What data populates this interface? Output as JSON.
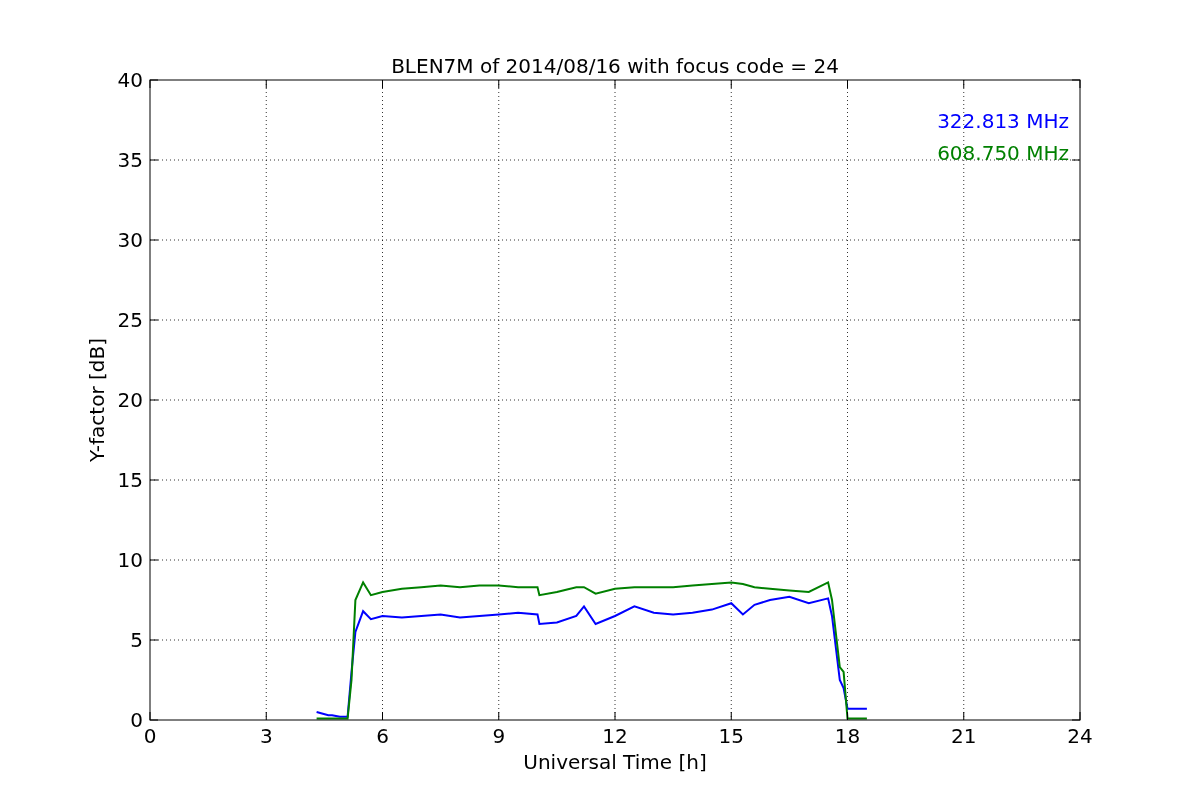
{
  "chart_data": {
    "type": "line",
    "title": "BLEN7M of 2014/08/16 with focus code = 24",
    "xlabel": "Universal Time [h]",
    "ylabel": "Y-factor [dB]",
    "xlim": [
      0,
      24
    ],
    "ylim": [
      0,
      40
    ],
    "xticks": [
      0,
      3,
      6,
      9,
      12,
      15,
      18,
      21,
      24
    ],
    "yticks": [
      0,
      5,
      10,
      15,
      20,
      25,
      30,
      35,
      40
    ],
    "grid": true,
    "x": [
      4.3,
      4.6,
      4.7,
      4.9,
      5.1,
      5.2,
      5.3,
      5.5,
      5.7,
      6,
      6.5,
      7,
      7.5,
      8,
      8.5,
      9,
      9.5,
      10,
      10.05,
      10.5,
      11,
      11.2,
      11.5,
      12,
      12.5,
      13,
      13.5,
      14,
      14.5,
      15,
      15.3,
      15.6,
      16,
      16.5,
      17,
      17.5,
      17.6,
      17.8,
      17.9,
      18,
      18.5
    ],
    "series": [
      {
        "name": "322.813 MHz",
        "color": "#0000ff",
        "values": [
          0.5,
          0.3,
          0.3,
          0.2,
          0.2,
          3,
          5.5,
          6.8,
          6.3,
          6.5,
          6.4,
          6.5,
          6.6,
          6.4,
          6.5,
          6.6,
          6.7,
          6.6,
          6.0,
          6.1,
          6.5,
          7.1,
          6.0,
          6.5,
          7.1,
          6.7,
          6.6,
          6.7,
          6.9,
          7.3,
          6.6,
          7.2,
          7.5,
          7.7,
          7.3,
          7.6,
          6.5,
          2.5,
          2.0,
          0.7,
          0.7
        ]
      },
      {
        "name": "608.750 MHz",
        "color": "#008000",
        "values": [
          0.1,
          0.1,
          0.1,
          0.1,
          0.1,
          2.5,
          7.5,
          8.6,
          7.8,
          8.0,
          8.2,
          8.3,
          8.4,
          8.3,
          8.4,
          8.4,
          8.3,
          8.3,
          7.8,
          8.0,
          8.3,
          8.3,
          7.9,
          8.2,
          8.3,
          8.3,
          8.3,
          8.4,
          8.5,
          8.6,
          8.5,
          8.3,
          8.2,
          8.1,
          8.0,
          8.6,
          7.5,
          3.3,
          3.0,
          0.1,
          0.1
        ]
      }
    ]
  }
}
